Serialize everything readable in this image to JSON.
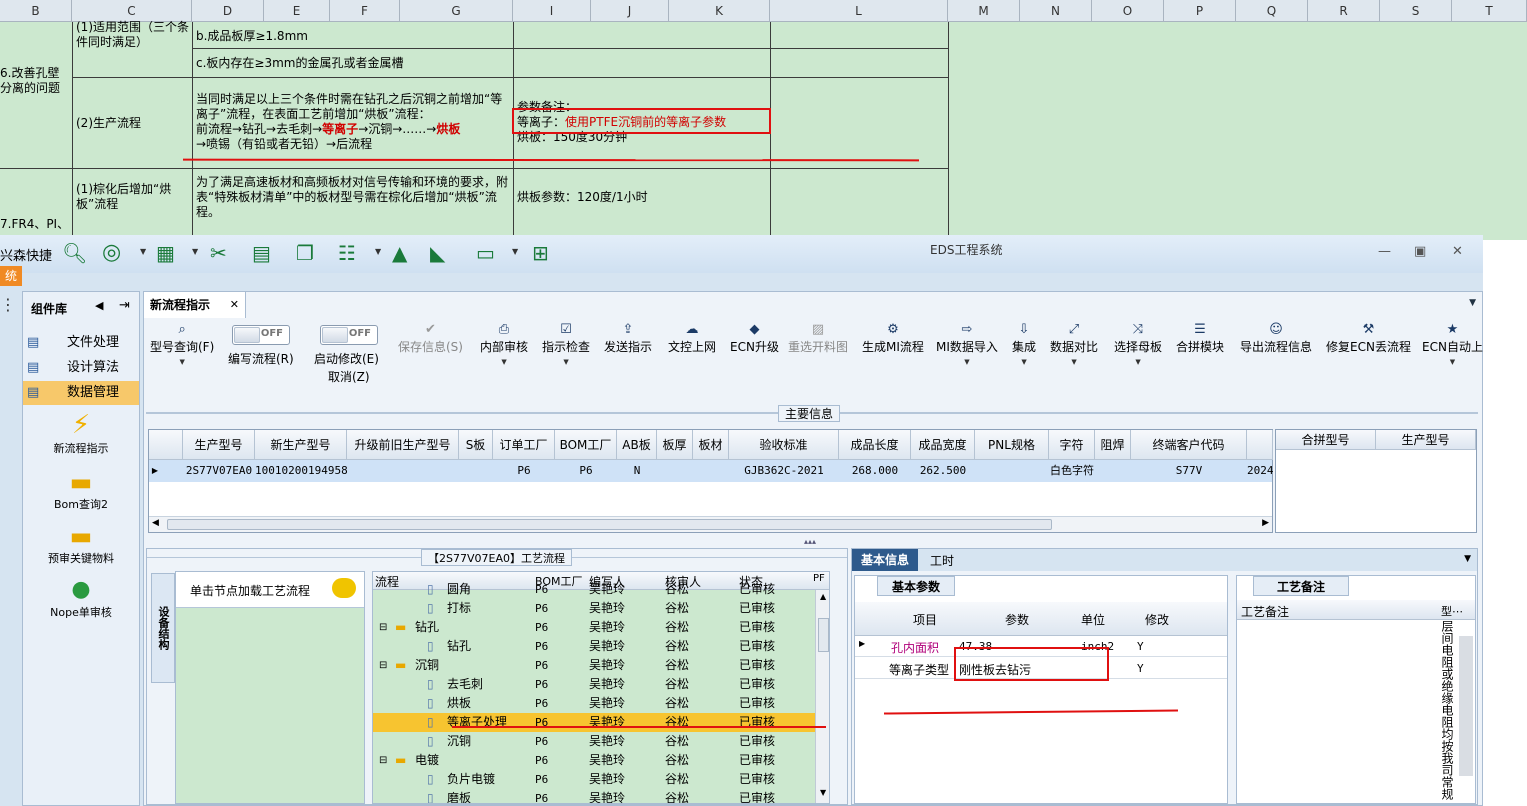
{
  "sheet": {
    "columns": [
      "B",
      "C",
      "D",
      "E",
      "F",
      "G",
      "I",
      "J",
      "K",
      "L",
      "M",
      "N",
      "O",
      "P",
      "Q",
      "R",
      "S",
      "T"
    ],
    "row1_c": "(1)适用范围（三个条件同时满足）",
    "row1_d": "b.成品板厚≥1.8mm",
    "row2_d": "c.板内存在≥3mm的金属孔或者金属槽",
    "b_label1": "6.改善孔壁分离的问题",
    "row3_c": "(2)生产流程",
    "row3_d_1": "当同时满足以上三个条件时需在钻孔之后沉铜之前增加“等离子”流程，在表面工艺前增加“烘板”流程：",
    "row3_d_2a": "前流程→钻孔→去毛刺→",
    "row3_d_2b": "等离子",
    "row3_d_2c": "→沉铜→……→",
    "row3_d_2d": "烘板",
    "row3_d_3": "→喷锡（有铅或者无铅）→后流程",
    "row3_i_1": "参数备注：",
    "row3_i_2a": "等离子：",
    "row3_i_2b": "使用PTFE沉铜前的等离子参数",
    "row3_i_3": "烘板：150度30分钟",
    "row4_c": "(1)棕化后增加“烘板”流程",
    "row4_d": "为了满足高速板材和高频板材对信号传输和环境的要求，附表“特殊板材清单”中的板材型号需在棕化后增加“烘板”流程。",
    "row4_i": "烘板参数：120度/1小时",
    "b_label2": "7.FR4、PI、"
  },
  "app": {
    "title": "EDS工程系统",
    "quick_label": "兴森快捷",
    "left_label": "统",
    "sidebar": {
      "title": "组件库",
      "items": [
        "文件处理",
        "设计算法",
        "数据管理"
      ],
      "big_items": [
        "新流程指示",
        "Bom查询2",
        "预审关键物料",
        "Nope单审核"
      ]
    },
    "tab": "新流程指示",
    "toolbar": {
      "b1": "型号查询(F)",
      "t1": "OFF",
      "b2": "编写流程(R)",
      "t2": "OFF",
      "b3a": "启动修改(E)",
      "b3b": "取消(Z)",
      "b4": "保存信息(S)",
      "b5": "内部审核",
      "b6": "指示检查",
      "b7": "发送指示",
      "b8": "文控上网",
      "b9": "ECN升级",
      "b10": "重选开料图",
      "b11": "生成MI流程",
      "b12": "MI数据导入",
      "b13": "集成",
      "b14": "数据对比",
      "b15": "选择母板",
      "b16": "合拼模块",
      "b17": "导出流程信息",
      "b18": "修复ECN丢流程",
      "b19": "ECN自动上"
    },
    "main_group": "主要信息",
    "main_headers": [
      "生产型号",
      "新生产型号",
      "升级前旧生产型号",
      "S板",
      "订单工厂",
      "BOM工厂",
      "AB板",
      "板厚",
      "板材",
      "验收标准",
      "成品长度",
      "成品宽度",
      "PNL规格",
      "字符",
      "阻焊",
      "终端客户代码"
    ],
    "main_row": [
      "2S77V07EA0",
      "10010200194958",
      "",
      "",
      "P6",
      "P6",
      "N",
      "",
      "",
      "GJB362C-2021",
      "268.000",
      "262.500",
      "",
      "白色字符",
      "",
      "S77V",
      "2024"
    ],
    "side_headers": [
      "合拼型号",
      "生产型号"
    ],
    "process_title": "【2S77V07EA0】工艺流程",
    "vtab": "设备结构",
    "load_hint": "单击节点加载工艺流程",
    "tree_headers": [
      "流程",
      "BOM工厂",
      "编写人",
      "核审人",
      "状态",
      "PF"
    ],
    "tree_rows": [
      {
        "name": "圆角",
        "factory": "P6",
        "writer": "吴艳玲",
        "checker": "谷松",
        "status": "已审核"
      },
      {
        "name": "打标",
        "factory": "P6",
        "writer": "吴艳玲",
        "checker": "谷松",
        "status": "已审核"
      },
      {
        "name": "钻孔",
        "factory": "P6",
        "writer": "吴艳玲",
        "checker": "谷松",
        "status": "已审核"
      },
      {
        "name": "钻孔",
        "factory": "P6",
        "writer": "吴艳玲",
        "checker": "谷松",
        "status": "已审核"
      },
      {
        "name": "沉铜",
        "factory": "P6",
        "writer": "吴艳玲",
        "checker": "谷松",
        "status": "已审核"
      },
      {
        "name": "去毛刺",
        "factory": "P6",
        "writer": "吴艳玲",
        "checker": "谷松",
        "status": "已审核"
      },
      {
        "name": "烘板",
        "factory": "P6",
        "writer": "吴艳玲",
        "checker": "谷松",
        "status": "已审核"
      },
      {
        "name": "等离子处理",
        "factory": "P6",
        "writer": "吴艳玲",
        "checker": "谷松",
        "status": "已审核"
      },
      {
        "name": "沉铜",
        "factory": "P6",
        "writer": "吴艳玲",
        "checker": "谷松",
        "status": "已审核"
      },
      {
        "name": "电镀",
        "factory": "P6",
        "writer": "吴艳玲",
        "checker": "谷松",
        "status": "已审核"
      },
      {
        "name": "负片电镀",
        "factory": "P6",
        "writer": "吴艳玲",
        "checker": "谷松",
        "status": "已审核"
      },
      {
        "name": "磨板",
        "factory": "P6",
        "writer": "吴艳玲",
        "checker": "谷松",
        "status": "已审核"
      }
    ],
    "right_tabs": [
      "基本信息",
      "工时"
    ],
    "params_title": "基本参数",
    "param_headers": [
      "项目",
      "参数",
      "单位",
      "修改"
    ],
    "param_rows": [
      [
        "孔内面积",
        "47.38",
        "inch2",
        "Y"
      ],
      [
        "等离子类型",
        "刚性板去钻污",
        "",
        "Y"
      ]
    ],
    "notes_title": "工艺备注",
    "notes_headers": [
      "工艺备注",
      "型⋯"
    ],
    "notes_vertical": "层间电阻或绝缘电阻均按我司常规"
  }
}
